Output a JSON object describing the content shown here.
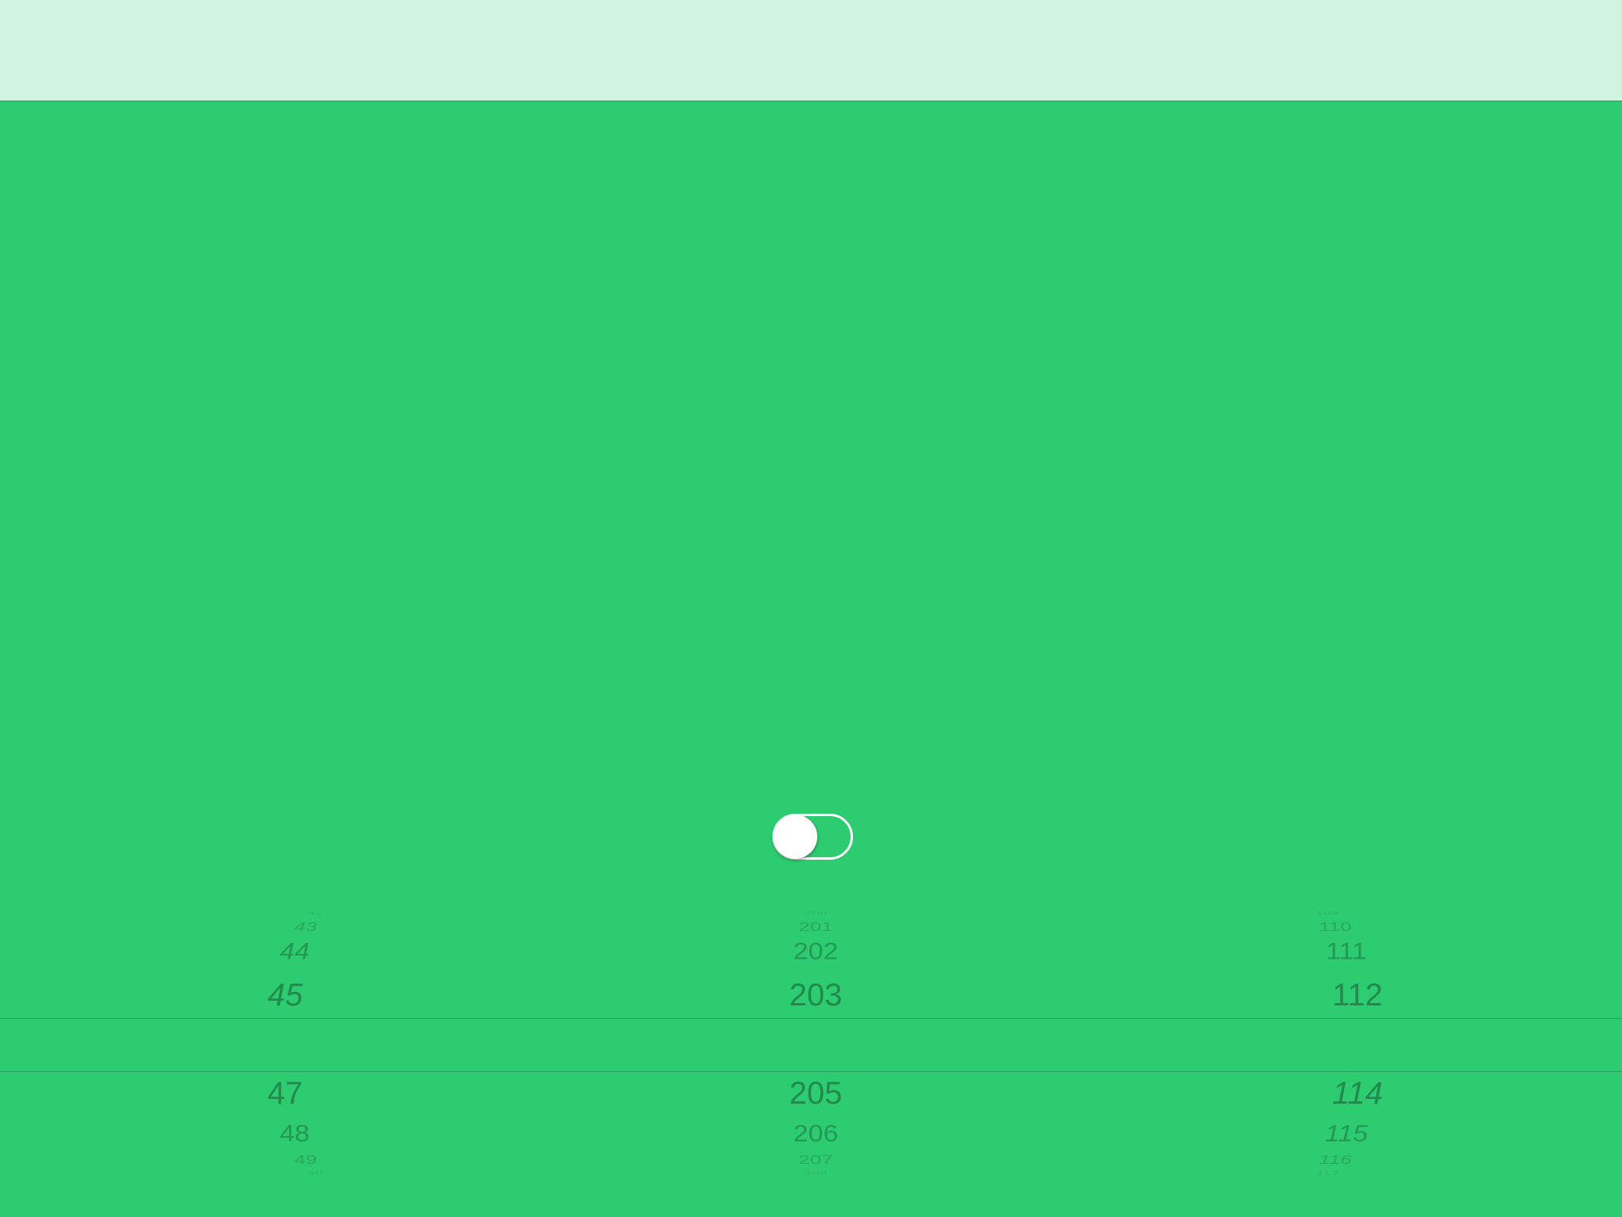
{
  "toggle": {
    "state": "off"
  },
  "picker": {
    "columns": [
      {
        "above": [
          "42",
          "43",
          "44",
          "45"
        ],
        "selected": "",
        "below": [
          "47",
          "48",
          "49",
          "50"
        ]
      },
      {
        "above": [
          "200",
          "201",
          "202",
          "203"
        ],
        "selected": "",
        "below": [
          "205",
          "206",
          "207",
          "208"
        ]
      },
      {
        "above": [
          "109",
          "110",
          "111",
          "112"
        ],
        "selected": "",
        "below": [
          "114",
          "115",
          "116",
          "117"
        ]
      }
    ]
  },
  "colors": {
    "background": "#2ecc71",
    "nav_bar": "#cff5e1",
    "picker_text": "#1e7a45",
    "toggle": "#ffffff"
  }
}
